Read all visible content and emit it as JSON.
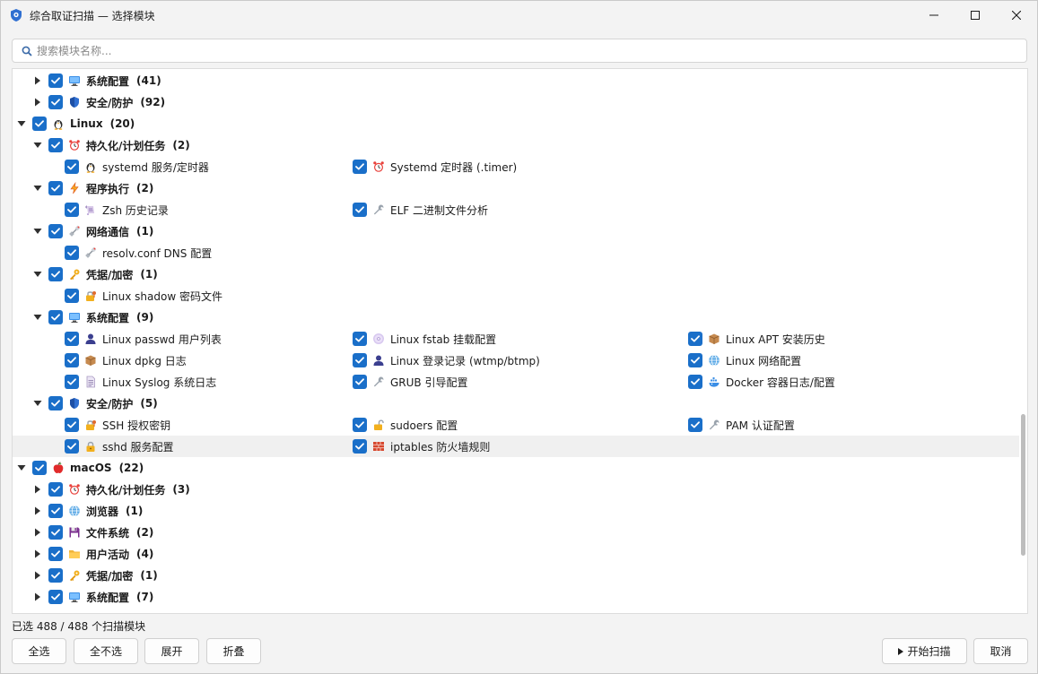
{
  "window": {
    "title": "综合取证扫描 — 选择模块"
  },
  "search": {
    "placeholder": "搜索模块名称..."
  },
  "tree": {
    "rows": [
      {
        "level": 1,
        "expanded": false,
        "label": "系统配置",
        "count": "(41)",
        "icon": "monitor-icon"
      },
      {
        "level": 1,
        "expanded": false,
        "label": "安全/防护",
        "count": "(92)",
        "icon": "shield-icon"
      },
      {
        "level": 0,
        "expanded": true,
        "label": "Linux",
        "count": "(20)",
        "icon": "penguin-icon"
      },
      {
        "level": 1,
        "expanded": true,
        "label": "持久化/计划任务",
        "count": "(2)",
        "icon": "alarm-clock-icon"
      },
      {
        "level": 2,
        "items": [
          {
            "label": "systemd 服务/定时器",
            "icon": "penguin-icon"
          },
          {
            "label": "Systemd 定时器 (.timer)",
            "icon": "alarm-clock-icon"
          }
        ]
      },
      {
        "level": 1,
        "expanded": true,
        "label": "程序执行",
        "count": "(2)",
        "icon": "lightning-icon"
      },
      {
        "level": 2,
        "items": [
          {
            "label": "Zsh 历史记录",
            "icon": "scroll-icon"
          },
          {
            "label": "ELF 二进制文件分析",
            "icon": "wrench-icon"
          }
        ]
      },
      {
        "level": 1,
        "expanded": true,
        "label": "网络通信",
        "count": "(1)",
        "icon": "satellite-icon"
      },
      {
        "level": 2,
        "items": [
          {
            "label": "resolv.conf DNS 配置",
            "icon": "satellite-icon"
          }
        ]
      },
      {
        "level": 1,
        "expanded": true,
        "label": "凭据/加密",
        "count": "(1)",
        "icon": "key-icon"
      },
      {
        "level": 2,
        "items": [
          {
            "label": "Linux shadow 密码文件",
            "icon": "locked-key-icon"
          }
        ]
      },
      {
        "level": 1,
        "expanded": true,
        "label": "系统配置",
        "count": "(9)",
        "icon": "monitor-icon"
      },
      {
        "level": 2,
        "items": [
          {
            "label": "Linux passwd 用户列表",
            "icon": "user-icon"
          },
          {
            "label": "Linux fstab 挂载配置",
            "icon": "disc-icon"
          },
          {
            "label": "Linux APT 安装历史",
            "icon": "package-icon"
          }
        ]
      },
      {
        "level": 2,
        "items": [
          {
            "label": "Linux dpkg 日志",
            "icon": "package-icon"
          },
          {
            "label": "Linux 登录记录 (wtmp/btmp)",
            "icon": "user-icon"
          },
          {
            "label": "Linux 网络配置",
            "icon": "globe-icon"
          }
        ]
      },
      {
        "level": 2,
        "items": [
          {
            "label": "Linux Syslog 系统日志",
            "icon": "document-icon"
          },
          {
            "label": "GRUB 引导配置",
            "icon": "wrench-icon"
          },
          {
            "label": "Docker 容器日志/配置",
            "icon": "whale-icon"
          }
        ]
      },
      {
        "level": 1,
        "expanded": true,
        "label": "安全/防护",
        "count": "(5)",
        "icon": "shield-icon"
      },
      {
        "level": 2,
        "items": [
          {
            "label": "SSH 授权密钥",
            "icon": "locked-key-icon"
          },
          {
            "label": "sudoers 配置",
            "icon": "unlocked-icon"
          },
          {
            "label": "PAM 认证配置",
            "icon": "wrench-icon"
          }
        ]
      },
      {
        "level": 2,
        "hover": true,
        "items": [
          {
            "label": "sshd 服务配置",
            "icon": "lock-icon"
          },
          {
            "label": "iptables 防火墙规则",
            "icon": "brick-icon"
          }
        ]
      },
      {
        "level": 0,
        "expanded": true,
        "label": "macOS",
        "count": "(22)",
        "icon": "apple-icon"
      },
      {
        "level": 1,
        "expanded": false,
        "label": "持久化/计划任务",
        "count": "(3)",
        "icon": "alarm-clock-icon"
      },
      {
        "level": 1,
        "expanded": false,
        "label": "浏览器",
        "count": "(1)",
        "icon": "globe-icon"
      },
      {
        "level": 1,
        "expanded": false,
        "label": "文件系统",
        "count": "(2)",
        "icon": "floppy-icon"
      },
      {
        "level": 1,
        "expanded": false,
        "label": "用户活动",
        "count": "(4)",
        "icon": "folder-icon"
      },
      {
        "level": 1,
        "expanded": false,
        "label": "凭据/加密",
        "count": "(1)",
        "icon": "key-icon"
      },
      {
        "level": 1,
        "expanded": false,
        "label": "系统配置",
        "count": "(7)",
        "icon": "monitor-icon"
      }
    ]
  },
  "status": {
    "selected_text": "已选 488 / 488 个扫描模块"
  },
  "buttons": {
    "select_all": "全选",
    "select_none": "全不选",
    "expand": "展开",
    "collapse": "折叠",
    "start_scan": "开始扫描",
    "cancel": "取消"
  },
  "colors": {
    "checkbox": "#1a6fc9",
    "accent": "#1a6fc9"
  }
}
